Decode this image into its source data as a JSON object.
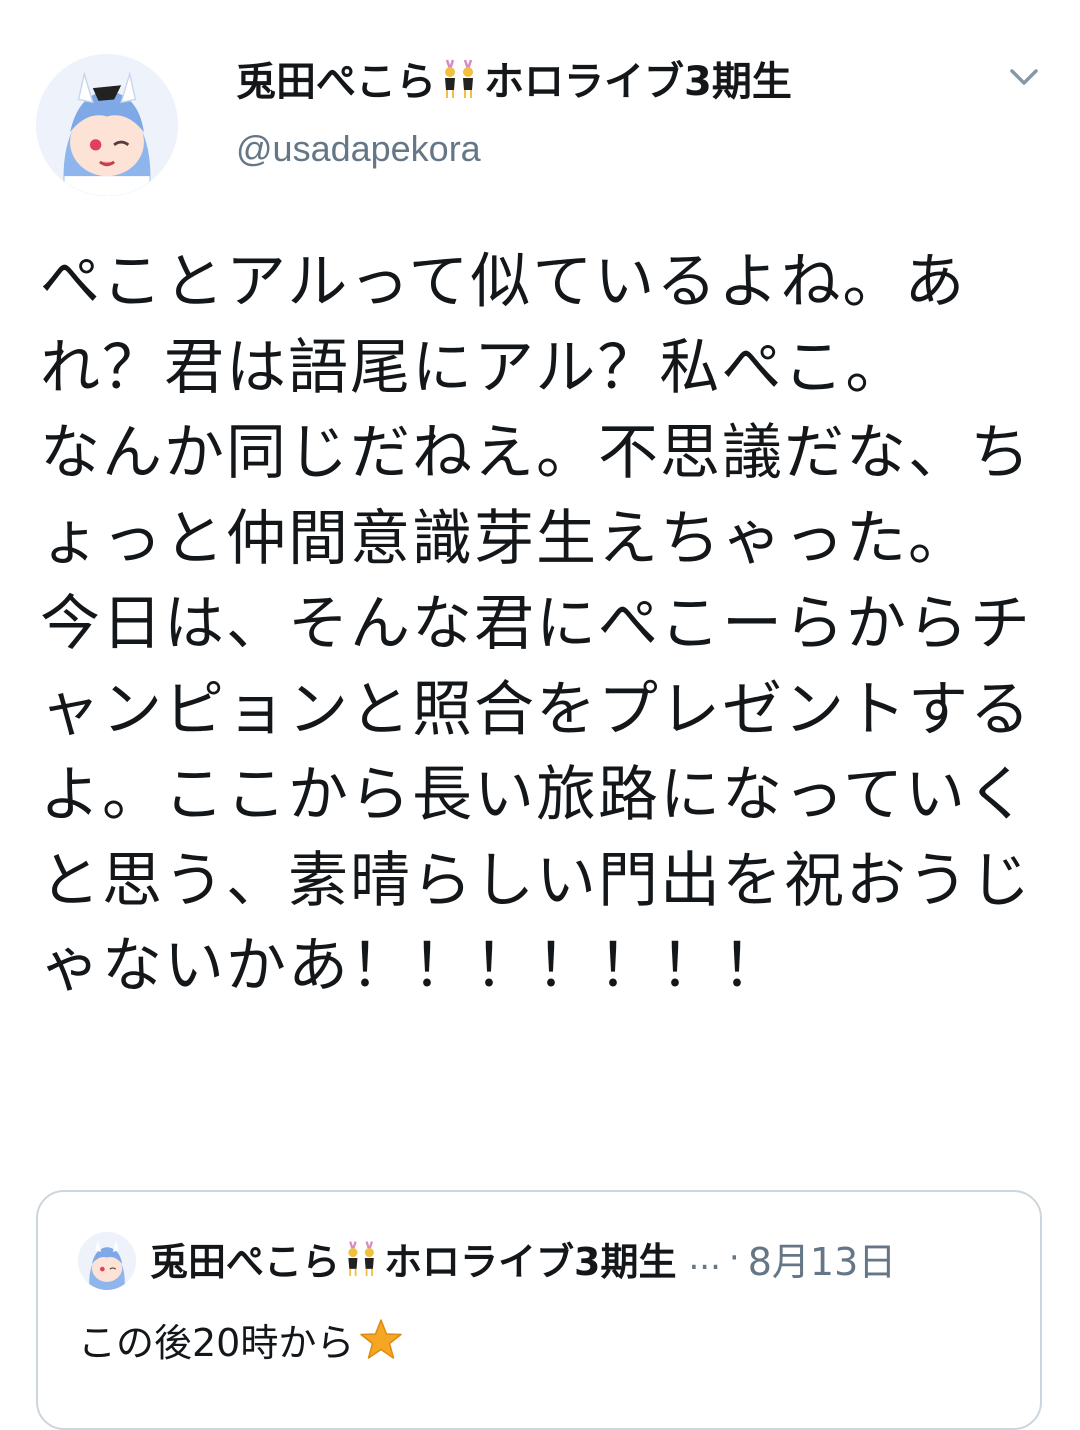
{
  "tweet": {
    "display_name": "兎田ぺこら",
    "name_emoji": "bunny-dancers-emoji",
    "name_suffix": "ホロライブ3期生",
    "handle": "@usadapekora",
    "caret_icon": "chevron-down-icon",
    "avatar_icon": "profile-avatar",
    "body_text": "ぺことアルって似ているよね。あれ？君は語尾にアル？私ぺこ。\nなんか同じだねえ。不思議だな、ちょっと仲間意識芽生えちゃった。\n今日は、そんな君にぺこーらからチャンピョンと照合をプレゼントするよ。ここから長い旅路になっていくと思う、素晴らしい門出を祝おうじゃないかあ！！！！！！！"
  },
  "quoted_tweet": {
    "display_name": "兎田ぺこら",
    "name_emoji": "bunny-dancers-emoji",
    "name_suffix": "ホロライブ3期生",
    "ellipsis": "...",
    "separator": "·",
    "date": "8月13日",
    "text": "この後20時から",
    "text_emoji": "star-emoji"
  },
  "colors": {
    "text_primary": "#14171a",
    "text_secondary": "#657786",
    "border": "#ccd6dd",
    "star": "#f5a623"
  }
}
